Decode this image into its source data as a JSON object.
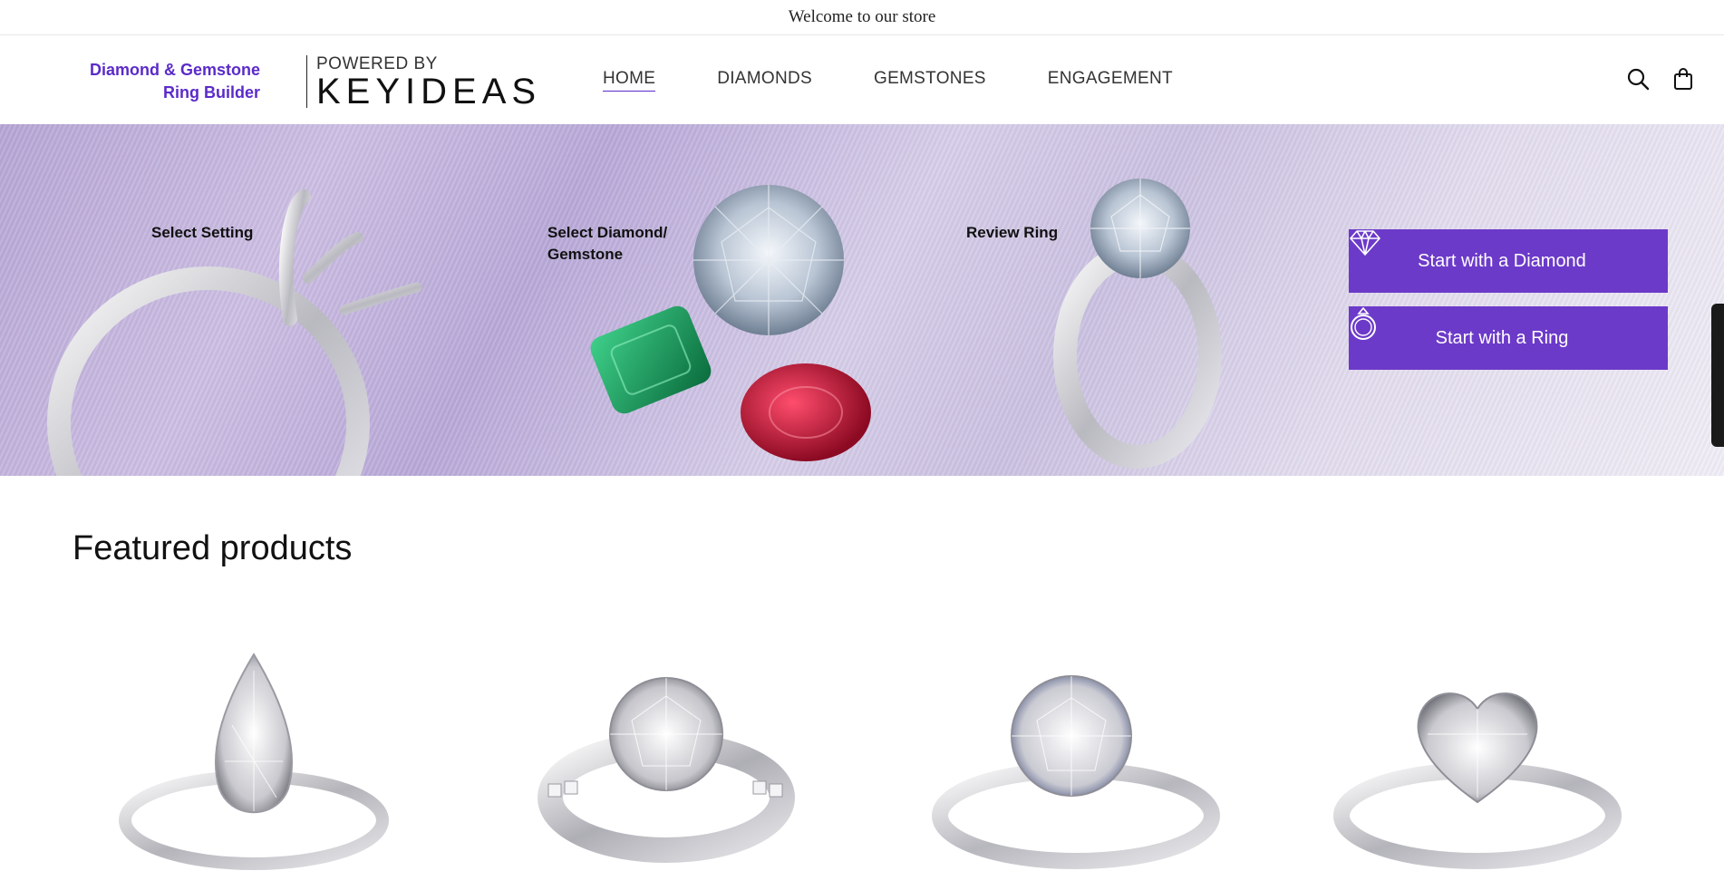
{
  "announcement": {
    "text": "Welcome to our store"
  },
  "header": {
    "brand_line1": "Diamond & Gemstone",
    "brand_line2": "Ring Builder",
    "powered_by": "POWERED BY",
    "logo_text": "KEYIDEAS",
    "nav": [
      {
        "label": "HOME",
        "active": true
      },
      {
        "label": "DIAMONDS",
        "active": false
      },
      {
        "label": "GEMSTONES",
        "active": false
      },
      {
        "label": "ENGAGEMENT",
        "active": false
      }
    ],
    "icons": [
      "search-icon",
      "bag-icon"
    ]
  },
  "hero": {
    "steps": [
      {
        "label": "Select Setting"
      },
      {
        "label_line1": "Select Diamond/",
        "label_line2": "Gemstone"
      },
      {
        "label": "Review Ring"
      }
    ],
    "cta_diamond": "Start with a Diamond",
    "cta_ring": "Start with a Ring",
    "colors": {
      "accent": "#6c3ac9",
      "brand_text": "#5b2bc9"
    }
  },
  "featured": {
    "title": "Featured products",
    "products": [
      {
        "icon": "pear-ring-image"
      },
      {
        "icon": "round-channel-ring-image"
      },
      {
        "icon": "round-solitaire-ring-image"
      },
      {
        "icon": "heart-ring-image"
      }
    ]
  }
}
